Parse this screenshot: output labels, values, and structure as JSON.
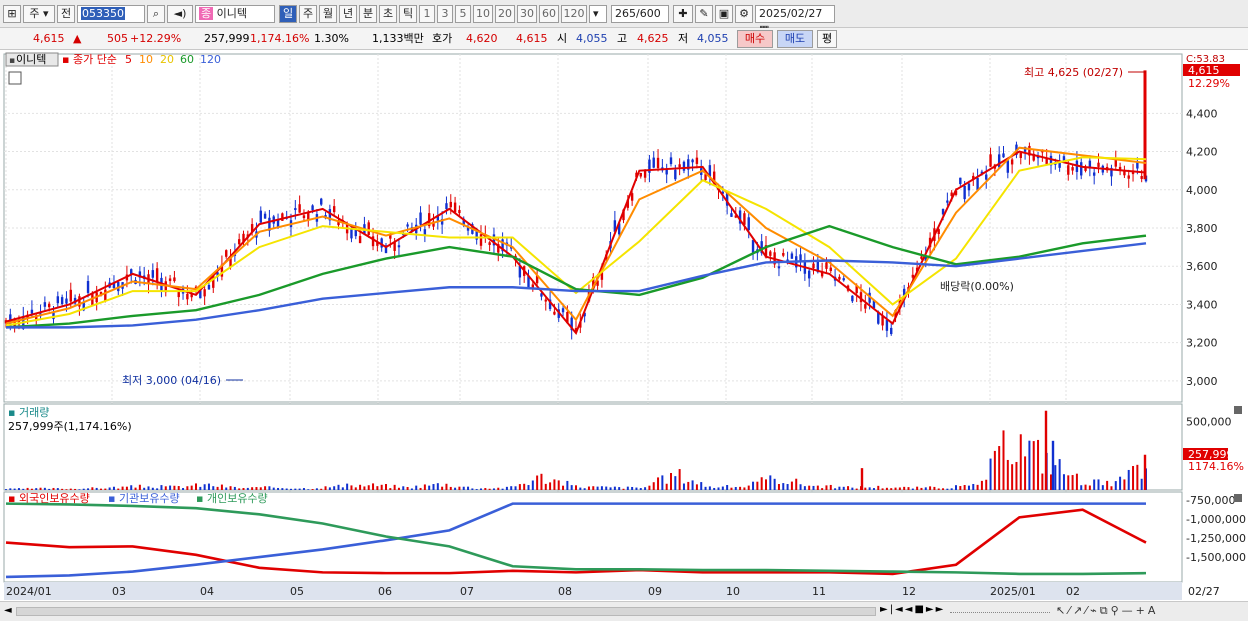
{
  "toolbar": {
    "market_type": "주",
    "prev_label": "전",
    "stock_code": "053350",
    "stock_name_badge": "종",
    "stock_name": "이니텍",
    "periods": [
      "일",
      "주",
      "월",
      "년",
      "분",
      "초",
      "틱"
    ],
    "active_period": "일",
    "intervals": [
      "1",
      "3",
      "5",
      "10",
      "20",
      "30",
      "60",
      "120"
    ],
    "count": "265",
    "count_max": "/600",
    "date": "2025/02/27"
  },
  "quote": {
    "price": "4,615",
    "change_arrow": "▲",
    "change": "505",
    "change_pct": "+12.29%",
    "volume": "257,999",
    "volume_pct": "1,174.16%",
    "turnover": "1.30%",
    "amount": "1,133백만",
    "bid_label": "호가",
    "bid1": "4,620",
    "bid2": "4,615",
    "open_label": "시",
    "open": "4,055",
    "high_label": "고",
    "high": "4,625",
    "low_label": "저",
    "low": "4,055",
    "buy_button": "매수",
    "sell_button": "매도",
    "eval_button": "평"
  },
  "colors": {
    "up": "#e00000",
    "down": "#1030d0",
    "ma5": "#e00000",
    "ma10": "#ff8c00",
    "ma20": "#f5e400",
    "ma60": "#1a9a2a",
    "ma120": "#3a5fd8",
    "foreign": "#e00000",
    "institution": "#3a5fd8",
    "individual": "#2e9a5a"
  },
  "chart_data": [
    {
      "type": "line",
      "title": "이니텍",
      "legend_label": "종가 단순",
      "series": [
        {
          "name": "5",
          "values": [
            3310,
            3400,
            3560,
            3450,
            3820,
            3900,
            3700,
            3900,
            3650,
            3250,
            4100,
            4120,
            3650,
            3560,
            3300,
            4000,
            4200,
            4120,
            4090
          ]
        },
        {
          "name": "10",
          "values": [
            3300,
            3380,
            3520,
            3480,
            3780,
            3860,
            3760,
            3850,
            3700,
            3320,
            3950,
            4100,
            3800,
            3620,
            3340,
            3880,
            4220,
            4180,
            4140
          ]
        },
        {
          "name": "20",
          "values": [
            3290,
            3350,
            3470,
            3470,
            3700,
            3810,
            3780,
            3750,
            3750,
            3460,
            3730,
            4050,
            3900,
            3700,
            3400,
            3640,
            4100,
            4170,
            4160
          ]
        },
        {
          "name": "60",
          "values": [
            3280,
            3300,
            3340,
            3370,
            3450,
            3560,
            3640,
            3700,
            3650,
            3480,
            3450,
            3540,
            3700,
            3810,
            3700,
            3610,
            3650,
            3720,
            3760
          ]
        },
        {
          "name": "120",
          "values": [
            3280,
            3280,
            3290,
            3320,
            3370,
            3430,
            3460,
            3490,
            3490,
            3470,
            3470,
            3550,
            3620,
            3630,
            3620,
            3600,
            3640,
            3680,
            3720
          ]
        }
      ],
      "x": [
        "2024/01",
        "",
        "03",
        "",
        "04",
        "05",
        "06",
        "07",
        "08",
        "",
        "09",
        "10",
        "11",
        "",
        "12",
        "2025/01",
        "",
        "02",
        "02/27"
      ],
      "ylim": [
        2900,
        4700
      ],
      "yticks": [
        3000,
        3200,
        3400,
        3600,
        3800,
        4000,
        4200,
        4400
      ],
      "annotations": {
        "high": "최고 4,625 (02/27)",
        "low": "최저 3,000 (04/16)",
        "dividend": "배당락(0.00%)",
        "current_price": "4,615",
        "current_change": "12.29%",
        "top_label": "C:53.83"
      }
    },
    {
      "type": "bar",
      "title": "거래량",
      "subtitle": "257,999주(1,174.16%)",
      "ylim": [
        0,
        600000
      ],
      "yticks": [
        500000
      ],
      "ytick_labels": [
        "500,000"
      ],
      "values": [
        12000,
        18000,
        15000,
        25000,
        40000,
        35000,
        60000,
        22000,
        30000,
        18000,
        45000,
        55000,
        30000,
        70000,
        20000,
        25000,
        150000,
        40000,
        30000,
        25000,
        180000,
        35000,
        40000,
        140000,
        50000,
        30000,
        35000,
        25000,
        30000,
        50000,
        580000,
        360000,
        120000,
        60000,
        257999
      ],
      "current": "257,999",
      "current_pct": "1174.16%"
    },
    {
      "type": "line",
      "title": "외국인보유수량 · 기관보유수량 · 개인보유수량",
      "legend": [
        "외국인보유수량",
        "기관보유수량",
        "개인보유수량"
      ],
      "ylim": [
        -1800000,
        -700000
      ],
      "yticks": [
        -750000,
        -1000000,
        -1250000,
        -1500000
      ],
      "ytick_labels": [
        "-750,000",
        "-1,000,000",
        "-1,250,000",
        "-1,500,000"
      ],
      "series": [
        {
          "name": "외국인보유수량",
          "values": [
            -1310000,
            -1370000,
            -1360000,
            -1470000,
            -1640000,
            -1700000,
            -1710000,
            -1710000,
            -1680000,
            -1700000,
            -1670000,
            -1700000,
            -1700000,
            -1700000,
            -1720000,
            -1600000,
            -980000,
            -880000,
            -1310000
          ]
        },
        {
          "name": "기관보유수량",
          "values": [
            -1760000,
            -1740000,
            -1690000,
            -1600000,
            -1500000,
            -1400000,
            -1280000,
            -1150000,
            -800000,
            -800000,
            -800000,
            -800000,
            -800000,
            -800000,
            -800000,
            -800000,
            -800000,
            -800000,
            -800000
          ]
        },
        {
          "name": "개인보유수량",
          "values": [
            -800000,
            -810000,
            -830000,
            -860000,
            -940000,
            -1060000,
            -1230000,
            -1360000,
            -1620000,
            -1660000,
            -1660000,
            -1670000,
            -1670000,
            -1680000,
            -1690000,
            -1700000,
            -1720000,
            -1720000,
            -1710000
          ]
        }
      ],
      "x": [
        "2024/01",
        "03",
        "04",
        "05",
        "06",
        "07",
        "08",
        "09",
        "10",
        "11",
        "12",
        "2025/01",
        "02"
      ]
    }
  ],
  "x_axis": {
    "labels": [
      "2024/01",
      "03",
      "04",
      "05",
      "06",
      "07",
      "08",
      "09",
      "10",
      "11",
      "12",
      "2025/01",
      "02"
    ],
    "last": "02/27"
  }
}
